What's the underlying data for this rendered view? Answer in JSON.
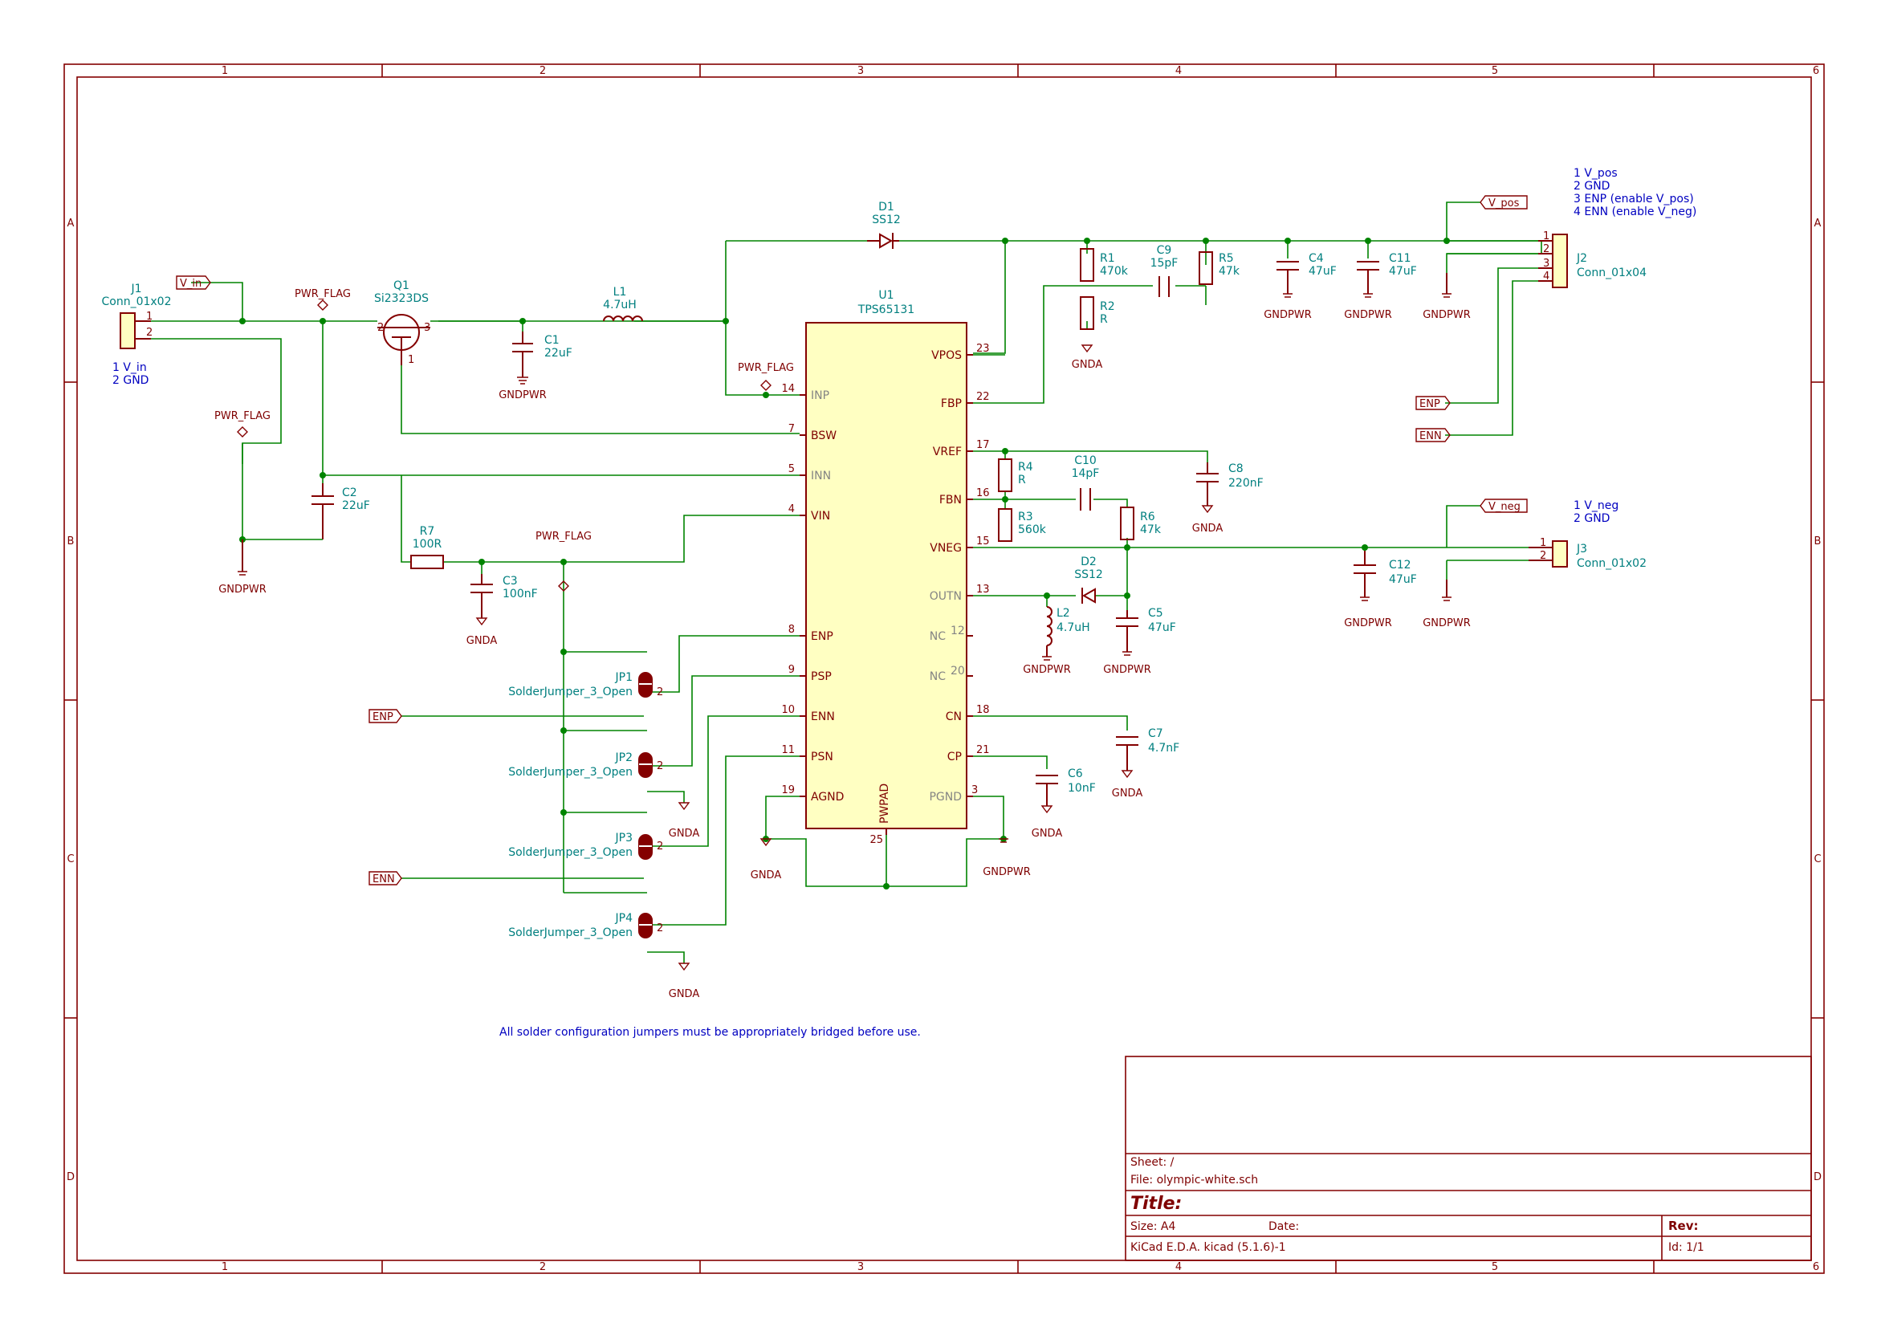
{
  "frame": {
    "columns": [
      "1",
      "2",
      "3",
      "4",
      "5",
      "6"
    ],
    "rows": [
      "A",
      "B",
      "C",
      "D"
    ]
  },
  "title_block": {
    "sheet": "Sheet: /",
    "file": "File: olympic-white.sch",
    "title": "Title:",
    "size": "Size: A4",
    "date": "Date:",
    "rev": "Rev:",
    "tool": "KiCad E.D.A.  kicad (5.1.6)-1",
    "id": "Id: 1/1"
  },
  "note": "All solder configuration jumpers must be appropriately bridged before use.",
  "connectors": {
    "j1": {
      "ref": "J1",
      "value": "Conn_01x02",
      "pins": [
        "1",
        "2"
      ],
      "desc": [
        "1 V_in",
        "2 GND"
      ]
    },
    "j2": {
      "ref": "J2",
      "value": "Conn_01x04",
      "pins": [
        "1",
        "2",
        "3",
        "4"
      ],
      "desc": [
        "1 V_pos",
        "2 GND",
        "3 ENP (enable V_pos)",
        "4 ENN (enable V_neg)"
      ]
    },
    "j3": {
      "ref": "J3",
      "value": "Conn_01x02",
      "pins": [
        "1",
        "2"
      ],
      "desc": [
        "1 V_neg",
        "2 GND"
      ]
    }
  },
  "labels": {
    "v_in": "V_in",
    "v_pos": "V_pos",
    "v_neg": "V_neg",
    "enp": "ENP",
    "enn": "ENN"
  },
  "power": {
    "pwr_flag": "PWR_FLAG",
    "gndpwr": "GNDPWR",
    "gnda": "GNDA",
    "gndpwr_pin": "GNDPWR",
    "gnda_pin": "GNDA"
  },
  "ic": {
    "ref": "U1",
    "value": "TPS65131",
    "left_pins": [
      {
        "num": "14",
        "name": "INP"
      },
      {
        "num": "7",
        "name": "BSW"
      },
      {
        "num": "5",
        "name": "INN"
      },
      {
        "num": "4",
        "name": "VIN"
      },
      {
        "num": "8",
        "name": "ENP"
      },
      {
        "num": "9",
        "name": "PSP"
      },
      {
        "num": "10",
        "name": "ENN"
      },
      {
        "num": "11",
        "name": "PSN"
      },
      {
        "num": "19",
        "name": "AGND"
      }
    ],
    "right_pins": [
      {
        "num": "23",
        "name": "VPOS"
      },
      {
        "num": "22",
        "name": "FBP"
      },
      {
        "num": "17",
        "name": "VREF"
      },
      {
        "num": "16",
        "name": "FBN"
      },
      {
        "num": "15",
        "name": "VNEG"
      },
      {
        "num": "13",
        "name": "OUTN"
      },
      {
        "num": "12",
        "name": "NC"
      },
      {
        "num": "20",
        "name": "NC"
      },
      {
        "num": "18",
        "name": "CN"
      },
      {
        "num": "21",
        "name": "CP"
      },
      {
        "num": "3",
        "name": "PGND"
      }
    ],
    "bottom_pin": {
      "num": "25",
      "name": "PWPAD"
    }
  },
  "components": {
    "q1": {
      "ref": "Q1",
      "value": "Si2323DS",
      "pins": [
        "2",
        "3",
        "1"
      ]
    },
    "l1": {
      "ref": "L1",
      "value": "4.7uH"
    },
    "l2": {
      "ref": "L2",
      "value": "4.7uH"
    },
    "d1": {
      "ref": "D1",
      "value": "SS12"
    },
    "d2": {
      "ref": "D2",
      "value": "SS12"
    },
    "c1": {
      "ref": "C1",
      "value": "22uF"
    },
    "c2": {
      "ref": "C2",
      "value": "22uF"
    },
    "c3": {
      "ref": "C3",
      "value": "100nF"
    },
    "c4": {
      "ref": "C4",
      "value": "47uF"
    },
    "c5": {
      "ref": "C5",
      "value": "47uF"
    },
    "c6": {
      "ref": "C6",
      "value": "10nF"
    },
    "c7": {
      "ref": "C7",
      "value": "4.7nF"
    },
    "c8": {
      "ref": "C8",
      "value": "220nF"
    },
    "c9": {
      "ref": "C9",
      "value": "15pF"
    },
    "c10": {
      "ref": "C10",
      "value": "14pF"
    },
    "c11": {
      "ref": "C11",
      "value": "47uF"
    },
    "c12": {
      "ref": "C12",
      "value": "47uF"
    },
    "r1": {
      "ref": "R1",
      "value": "470k"
    },
    "r2": {
      "ref": "R2",
      "value": "R"
    },
    "r3": {
      "ref": "R3",
      "value": "560k"
    },
    "r4": {
      "ref": "R4",
      "value": "R"
    },
    "r5": {
      "ref": "R5",
      "value": "47k"
    },
    "r6": {
      "ref": "R6",
      "value": "47k"
    },
    "r7": {
      "ref": "R7",
      "value": "100R"
    },
    "jp1": {
      "ref": "JP1",
      "value": "SolderJumper_3_Open"
    },
    "jp2": {
      "ref": "JP2",
      "value": "SolderJumper_3_Open"
    },
    "jp3": {
      "ref": "JP3",
      "value": "SolderJumper_3_Open"
    },
    "jp4": {
      "ref": "JP4",
      "value": "SolderJumper_3_Open"
    }
  },
  "pin_small": {
    "one": "1",
    "two": "2",
    "three": "3"
  },
  "colors": {
    "border": "#840000",
    "wire": "#008400",
    "text": "#007f7f",
    "ic_fill": "#ffffc2",
    "note": "#0000c0"
  }
}
